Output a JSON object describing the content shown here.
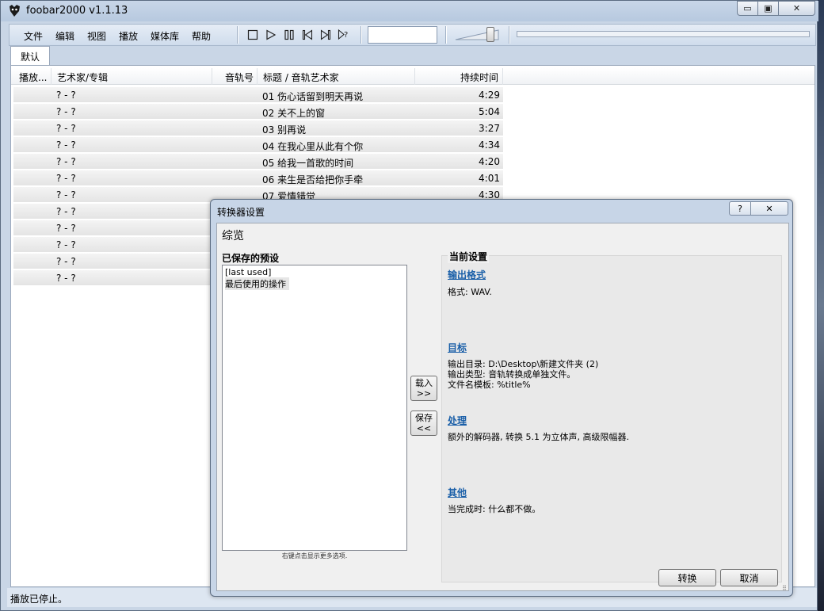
{
  "window": {
    "title": "foobar2000 v1.1.13",
    "min_label": "▭",
    "max_label": "▣",
    "close_label": "✕"
  },
  "menu": [
    "文件",
    "编辑",
    "视图",
    "播放",
    "媒体库",
    "帮助"
  ],
  "toolbar": {
    "search_value": ""
  },
  "tabs": [
    "默认"
  ],
  "columns": [
    "播放...",
    "艺术家/专辑",
    "音轨号",
    "标题 / 音轨艺术家",
    "持续时间"
  ],
  "rows": [
    {
      "artist": "? - ?",
      "title": "01 伤心话留到明天再说",
      "duration": "4:29"
    },
    {
      "artist": "? - ?",
      "title": "02 关不上的窗",
      "duration": "5:04"
    },
    {
      "artist": "? - ?",
      "title": "03 别再说",
      "duration": "3:27"
    },
    {
      "artist": "? - ?",
      "title": "04 在我心里从此有个你",
      "duration": "4:34"
    },
    {
      "artist": "? - ?",
      "title": "05 给我一首歌的时间",
      "duration": "4:20"
    },
    {
      "artist": "? - ?",
      "title": "06 来生是否给把你手牵",
      "duration": "4:01"
    },
    {
      "artist": "? - ?",
      "title": "07 爱情错觉",
      "duration": "4:30"
    },
    {
      "artist": "? - ?",
      "title": "",
      "duration": ""
    },
    {
      "artist": "? - ?",
      "title": "",
      "duration": ""
    },
    {
      "artist": "? - ?",
      "title": "",
      "duration": ""
    },
    {
      "artist": "? - ?",
      "title": "",
      "duration": ""
    },
    {
      "artist": "? - ?",
      "title": "",
      "duration": ""
    }
  ],
  "status": "播放已停止。",
  "dialog": {
    "title": "转换器设置",
    "help_label": "?",
    "close_label": "✕",
    "overview": "综览",
    "saved_presets_label": "已保存的预设",
    "presets": [
      "[last used]",
      "最后使用的操作"
    ],
    "preset_hint": "右键点击显示更多选项.",
    "load_btn": [
      "载入",
      ">>"
    ],
    "save_btn": [
      "保存",
      "<<"
    ],
    "current_label": "当前设置",
    "sections": [
      {
        "title": "输出格式",
        "text": "格式: WAV."
      },
      {
        "title": "目标",
        "text": "输出目录: D:\\Desktop\\新建文件夹 (2)\n输出类型: 音轨转换成单独文件。\n文件名模板: %title%"
      },
      {
        "title": "处理",
        "text": "额外的解码器, 转换 5.1 为立体声, 高级限幅器."
      },
      {
        "title": "其他",
        "text": "当完成时: 什么都不做。"
      }
    ],
    "convert_label": "转换",
    "cancel_label": "取消"
  }
}
